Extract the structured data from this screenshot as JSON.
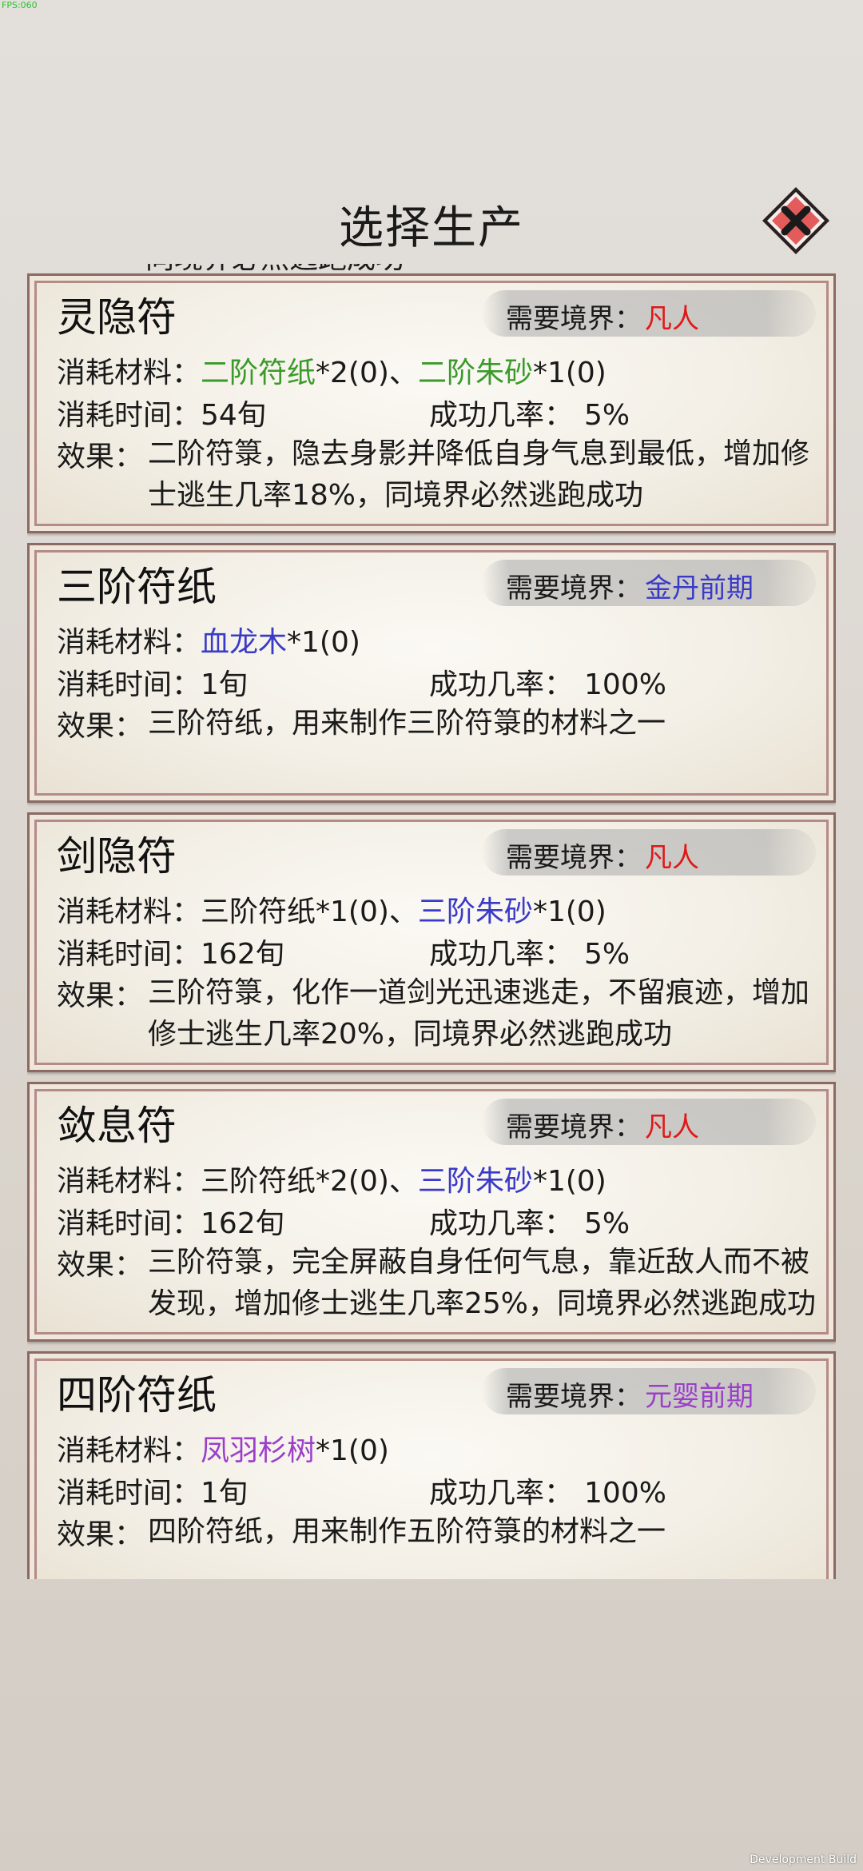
{
  "debug": {
    "fps": "FPS:060",
    "build": "Development Build"
  },
  "header": {
    "title": "选择生产"
  },
  "clipped_text": "同境界必然逃跑成功",
  "labels": {
    "realm": "需要境界：",
    "materials": "消耗材料：",
    "time": "消耗时间：",
    "rate": "成功几率：",
    "effect": "效果："
  },
  "colors": {
    "red": "#e01818",
    "blue": "#3a3ac8",
    "purple": "#9b3fc9",
    "green": "#3a9a2a"
  },
  "recipes": [
    {
      "name": "灵隐符",
      "realm": "凡人",
      "realm_color": "red",
      "materials": [
        {
          "text": "二阶符纸",
          "color": "green"
        },
        {
          "text": "*2(0)、",
          "color": ""
        },
        {
          "text": "二阶朱砂",
          "color": "green"
        },
        {
          "text": "*1(0)",
          "color": ""
        }
      ],
      "time": "54旬",
      "rate": "5%",
      "effect": "二阶符箓，隐去身影并降低自身气息到最低，增加修士逃生几率18%，同境界必然逃跑成功"
    },
    {
      "name": "三阶符纸",
      "realm": "金丹前期",
      "realm_color": "blue",
      "materials": [
        {
          "text": "血龙木",
          "color": "blue"
        },
        {
          "text": "*1(0)",
          "color": ""
        }
      ],
      "time": "1旬",
      "rate": "100%",
      "effect": "三阶符纸，用来制作三阶符箓的材料之一"
    },
    {
      "name": "剑隐符",
      "realm": "凡人",
      "realm_color": "red",
      "materials": [
        {
          "text": "三阶符纸*1(0)、",
          "color": ""
        },
        {
          "text": "三阶朱砂",
          "color": "blue"
        },
        {
          "text": "*1(0)",
          "color": ""
        }
      ],
      "time": "162旬",
      "rate": "5%",
      "effect": "三阶符箓，化作一道剑光迅速逃走，不留痕迹，增加修士逃生几率20%，同境界必然逃跑成功"
    },
    {
      "name": "敛息符",
      "realm": "凡人",
      "realm_color": "red",
      "materials": [
        {
          "text": "三阶符纸*2(0)、",
          "color": ""
        },
        {
          "text": "三阶朱砂",
          "color": "blue"
        },
        {
          "text": "*1(0)",
          "color": ""
        }
      ],
      "time": "162旬",
      "rate": "5%",
      "effect": "三阶符箓，完全屏蔽自身任何气息，靠近敌人而不被发现，增加修士逃生几率25%，同境界必然逃跑成功"
    },
    {
      "name": "四阶符纸",
      "realm": "元婴前期",
      "realm_color": "purple",
      "materials": [
        {
          "text": "凤羽杉树",
          "color": "purple"
        },
        {
          "text": "*1(0)",
          "color": ""
        }
      ],
      "time": "1旬",
      "rate": "100%",
      "effect": "四阶符纸，用来制作五阶符箓的材料之一"
    }
  ]
}
